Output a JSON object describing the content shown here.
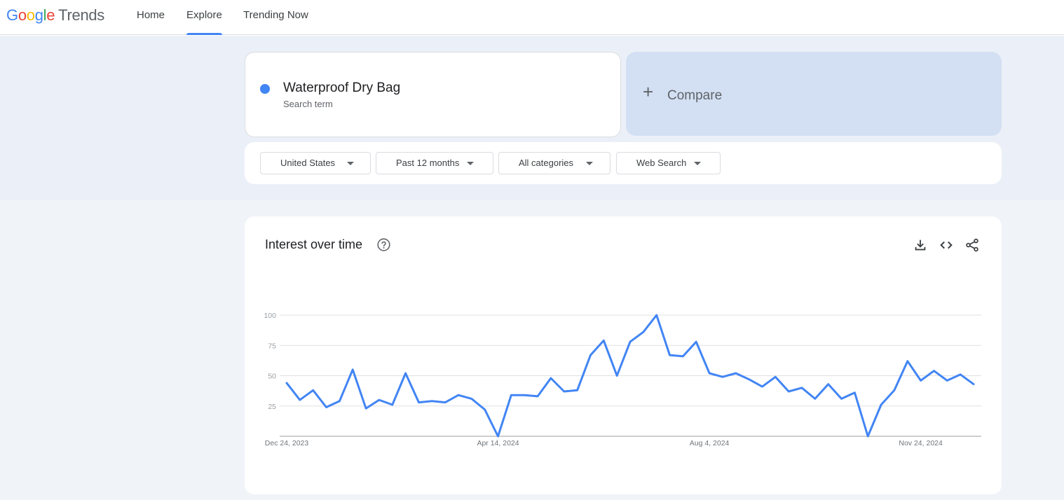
{
  "header": {
    "logo_google": [
      "G",
      "o",
      "o",
      "g",
      "l",
      "e"
    ],
    "logo_trends": "Trends",
    "nav": [
      {
        "label": "Home",
        "active": false
      },
      {
        "label": "Explore",
        "active": true
      },
      {
        "label": "Trending Now",
        "active": false
      }
    ]
  },
  "search": {
    "term": "Waterproof Dry Bag",
    "term_type": "Search term",
    "term_color": "#4285f4",
    "compare_label": "Compare"
  },
  "filters": [
    {
      "label": "United States"
    },
    {
      "label": "Past 12 months"
    },
    {
      "label": "All categories"
    },
    {
      "label": "Web Search"
    }
  ],
  "panel": {
    "title": "Interest over time",
    "icons": [
      "help-icon",
      "download-icon",
      "embed-code-icon",
      "share-icon"
    ]
  },
  "chart_data": {
    "type": "line",
    "color": "#4285f4",
    "ylim": [
      0,
      100
    ],
    "y_ticks": [
      25,
      50,
      75,
      100
    ],
    "x_tick_labels": [
      "Dec 24, 2023",
      "Apr 14, 2024",
      "Aug 4, 2024",
      "Nov 24, 2024"
    ],
    "x_tick_indices": [
      0,
      16,
      32,
      48
    ],
    "grid": true,
    "series": [
      {
        "values": [
          44,
          30,
          38,
          24,
          29,
          55,
          23,
          30,
          26,
          52,
          28,
          29,
          28,
          34,
          31,
          22,
          0,
          34,
          34,
          33,
          48,
          37,
          38,
          67,
          79,
          50,
          78,
          86,
          100,
          67,
          66,
          78,
          52,
          49,
          52,
          47,
          41,
          49,
          37,
          40,
          31,
          43,
          31,
          36,
          0,
          26,
          38,
          62,
          46,
          54,
          46,
          51,
          43
        ]
      }
    ]
  }
}
